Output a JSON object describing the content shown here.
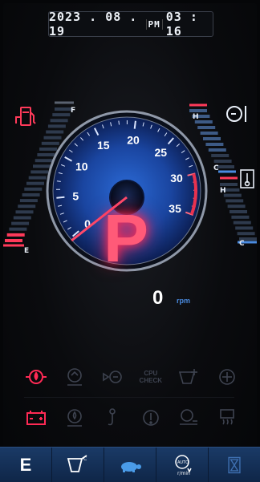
{
  "datetime": {
    "date": "2023 . 08 . 19",
    "ampm": "PM",
    "time": "03 : 16"
  },
  "fuel_gauge": {
    "full_label": "F",
    "empty_label": "E",
    "level_fraction": 0.08
  },
  "temp_gauge": {
    "hot_label": "H",
    "cold_label": "C",
    "level_fraction": 0.7
  },
  "hyd_gauge": {
    "hot_label": "H",
    "cold_label": "C",
    "level_fraction": 0.0
  },
  "speedometer": {
    "ticks": [
      "0",
      "5",
      "10",
      "15",
      "20",
      "25",
      "30",
      "35"
    ],
    "needle_value": 0
  },
  "gear": "P",
  "rpm": {
    "value": "0",
    "unit": "rpm"
  },
  "indicators_row1": [
    {
      "icon": "engine-oil-pressure-icon",
      "active": true,
      "color": "#ff2a55"
    },
    {
      "icon": "preheat-icon",
      "active": false
    },
    {
      "icon": "coolant-icon",
      "active": false
    },
    {
      "icon": "cpu-check-icon",
      "active": false,
      "text": "CPU\nCHECK"
    },
    {
      "icon": "bucket-warning-icon",
      "active": false
    },
    {
      "icon": "air-filter-icon",
      "active": false
    }
  ],
  "indicators_row2": [
    {
      "icon": "battery-icon",
      "active": true,
      "color": "#ff2a55"
    },
    {
      "icon": "water-separator-icon",
      "active": false
    },
    {
      "icon": "hook-icon",
      "active": false
    },
    {
      "icon": "hydraulic-filter-icon",
      "active": false
    },
    {
      "icon": "engine-speed-icon",
      "active": false
    },
    {
      "icon": "glow-plug-icon",
      "active": false
    }
  ],
  "bottom_bar": [
    {
      "icon": "eco-mode-icon",
      "label": "E"
    },
    {
      "icon": "bucket-mode-icon",
      "label": ""
    },
    {
      "icon": "turtle-slow-icon",
      "label": ""
    },
    {
      "icon": "auto-idle-icon",
      "label": ""
    },
    {
      "icon": "hourglass-icon",
      "label": ""
    }
  ],
  "colors": {
    "accent_red": "#ff2a55",
    "accent_blue": "#4a8be0",
    "dial_blue": "#1c4ea8",
    "inactive": "#3e4350"
  }
}
